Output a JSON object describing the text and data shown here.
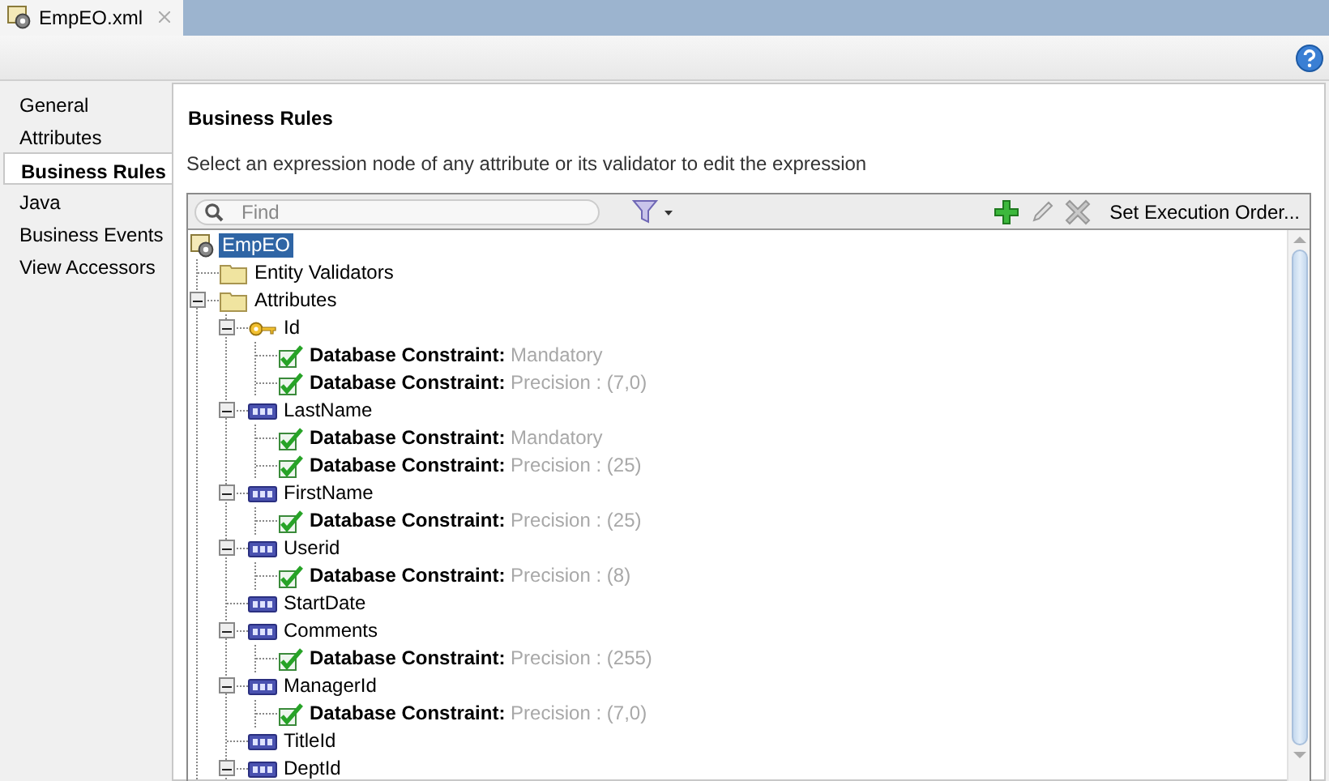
{
  "editor_tabs": [
    {
      "label": "EmpEO.xml",
      "selected": true
    }
  ],
  "nav": [
    {
      "label": "General",
      "selected": false
    },
    {
      "label": "Attributes",
      "selected": false
    },
    {
      "label": "Business Rules",
      "selected": true
    },
    {
      "label": "Java",
      "selected": false
    },
    {
      "label": "Business Events",
      "selected": false
    },
    {
      "label": "View Accessors",
      "selected": false
    }
  ],
  "panel": {
    "title": "Business Rules",
    "description": "Select an expression node of any attribute or its validator to edit the expression"
  },
  "toolbar": {
    "search": {
      "placeholder": "Find"
    },
    "set_order_button": "Set Execution Order..."
  },
  "tree": [
    {
      "kind": "entity",
      "label": "EmpEO",
      "selected": true,
      "children": [
        {
          "kind": "folder",
          "label": "Entity Validators",
          "selected": false
        },
        {
          "kind": "folder",
          "label": "Attributes",
          "selected": false,
          "expanded": true,
          "children": [
            {
              "kind": "key",
              "label": "Id",
              "selected": false,
              "expanded": true,
              "children": [
                {
                  "kind": "constraint",
                  "label": "Database Constraint:",
                  "detail": "Mandatory",
                  "selected": false
                },
                {
                  "kind": "constraint",
                  "label": "Database Constraint:",
                  "detail": "Precision : (7,0)",
                  "selected": false
                }
              ]
            },
            {
              "kind": "attribute",
              "label": "LastName",
              "selected": false,
              "expanded": true,
              "children": [
                {
                  "kind": "constraint",
                  "label": "Database Constraint:",
                  "detail": "Mandatory",
                  "selected": false
                },
                {
                  "kind": "constraint",
                  "label": "Database Constraint:",
                  "detail": "Precision : (25)",
                  "selected": false
                }
              ]
            },
            {
              "kind": "attribute",
              "label": "FirstName",
              "selected": false,
              "expanded": true,
              "children": [
                {
                  "kind": "constraint",
                  "label": "Database Constraint:",
                  "detail": "Precision : (25)",
                  "selected": false
                }
              ]
            },
            {
              "kind": "attribute",
              "label": "Userid",
              "selected": false,
              "expanded": true,
              "children": [
                {
                  "kind": "constraint",
                  "label": "Database Constraint:",
                  "detail": "Precision : (8)",
                  "selected": false
                }
              ]
            },
            {
              "kind": "attribute",
              "label": "StartDate",
              "selected": false
            },
            {
              "kind": "attribute",
              "label": "Comments",
              "selected": false,
              "expanded": true,
              "children": [
                {
                  "kind": "constraint",
                  "label": "Database Constraint:",
                  "detail": "Precision : (255)",
                  "selected": false
                }
              ]
            },
            {
              "kind": "attribute",
              "label": "ManagerId",
              "selected": false,
              "expanded": true,
              "children": [
                {
                  "kind": "constraint",
                  "label": "Database Constraint:",
                  "detail": "Precision : (7,0)",
                  "selected": false
                }
              ]
            },
            {
              "kind": "attribute",
              "label": "TitleId",
              "selected": false
            },
            {
              "kind": "attribute",
              "label": "DeptId",
              "selected": false,
              "expanded": true
            }
          ]
        }
      ]
    }
  ]
}
